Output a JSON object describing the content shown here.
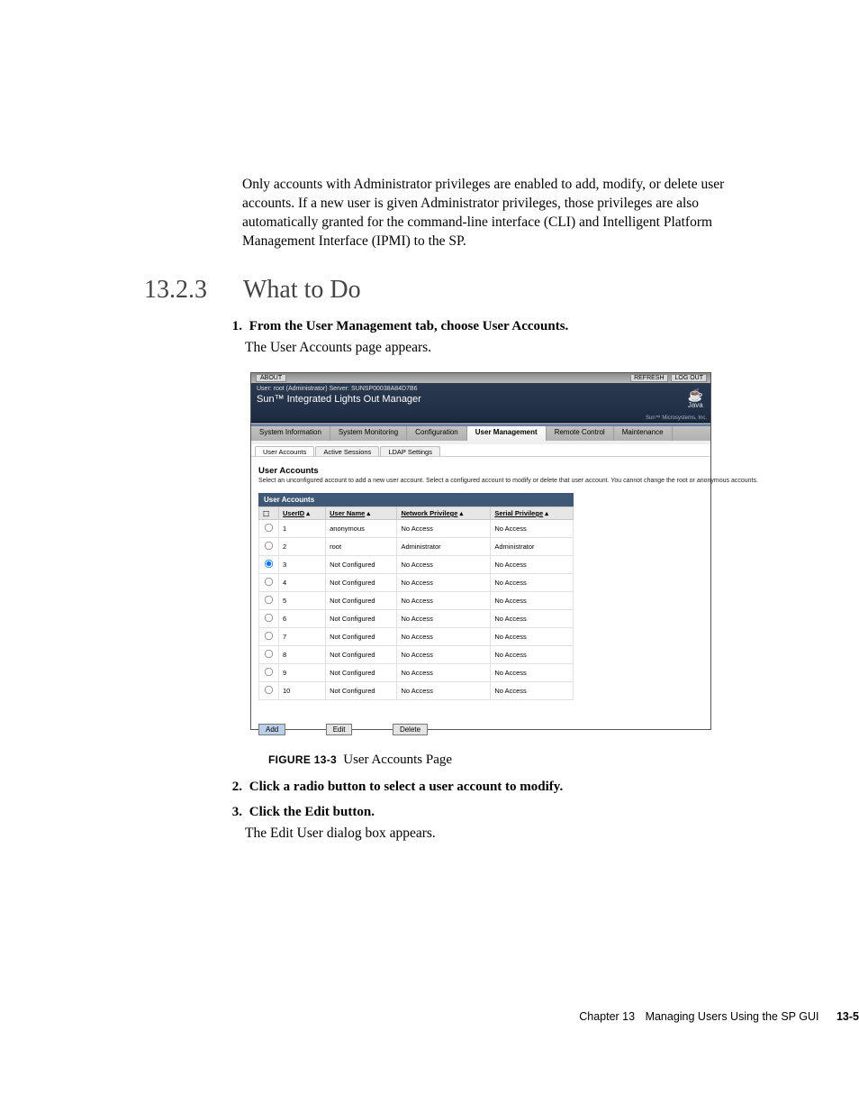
{
  "intro_paragraph": "Only accounts with Administrator privileges are enabled to add, modify, or delete user accounts. If a new user is given Administrator privileges, those privileges are also automatically granted for the command-line interface (CLI) and Intelligent Platform Management Interface (IPMI) to the SP.",
  "section": {
    "number": "13.2.3",
    "title": "What to Do"
  },
  "step1": {
    "num": "1.",
    "text": "From the User Management tab, choose User Accounts.",
    "body": "The User Accounts page appears."
  },
  "step2": {
    "num": "2.",
    "text": "Click a radio button to select a user account to modify."
  },
  "step3": {
    "num": "3.",
    "text": "Click the Edit button.",
    "body": "The Edit User dialog box appears."
  },
  "figure": {
    "label": "FIGURE 13-3",
    "caption": "User Accounts Page"
  },
  "footer": {
    "chapter": "Chapter 13",
    "title": "Managing Users Using the SP GUI",
    "page": "13-5"
  },
  "shot": {
    "about": "ABOUT",
    "refresh": "REFRESH",
    "logout": "LOG OUT",
    "userline": "User: root (Administrator)   Server: SUNSP00038A84D7B6",
    "prodline": "Sun™ Integrated Lights Out Manager",
    "java": "Java",
    "micro": "Sun™ Microsystems, Inc.",
    "main_tabs": [
      "System Information",
      "System Monitoring",
      "Configuration",
      "User Management",
      "Remote Control",
      "Maintenance"
    ],
    "main_active_index": 3,
    "sub_tabs": [
      "User Accounts",
      "Active Sessions",
      "LDAP Settings"
    ],
    "sub_active_index": 0,
    "section_head": "User Accounts",
    "section_desc": "Select an unconfigured account to add a new user account. Select a configured account to modify or delete that user account. You cannot change the root or anonymous accounts.",
    "table_title": "User Accounts",
    "columns": {
      "sel": "",
      "userid": "UserID",
      "username": "User Name",
      "net": "Network Privilege",
      "serial": "Serial Privilege"
    },
    "rows": [
      {
        "sel": false,
        "id": "1",
        "name": "anonymous",
        "net": "No Access",
        "serial": "No Access"
      },
      {
        "sel": false,
        "id": "2",
        "name": "root",
        "net": "Administrator",
        "serial": "Administrator"
      },
      {
        "sel": true,
        "id": "3",
        "name": "Not Configured",
        "net": "No Access",
        "serial": "No Access"
      },
      {
        "sel": false,
        "id": "4",
        "name": "Not Configured",
        "net": "No Access",
        "serial": "No Access"
      },
      {
        "sel": false,
        "id": "5",
        "name": "Not Configured",
        "net": "No Access",
        "serial": "No Access"
      },
      {
        "sel": false,
        "id": "6",
        "name": "Not Configured",
        "net": "No Access",
        "serial": "No Access"
      },
      {
        "sel": false,
        "id": "7",
        "name": "Not Configured",
        "net": "No Access",
        "serial": "No Access"
      },
      {
        "sel": false,
        "id": "8",
        "name": "Not Configured",
        "net": "No Access",
        "serial": "No Access"
      },
      {
        "sel": false,
        "id": "9",
        "name": "Not Configured",
        "net": "No Access",
        "serial": "No Access"
      },
      {
        "sel": false,
        "id": "10",
        "name": "Not Configured",
        "net": "No Access",
        "serial": "No Access"
      }
    ],
    "buttons": {
      "add": "Add",
      "edit": "Edit",
      "delete": "Delete"
    }
  }
}
